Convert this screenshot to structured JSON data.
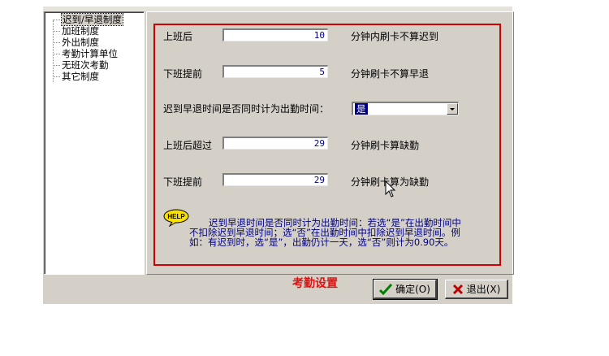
{
  "tree": {
    "items": [
      {
        "label": "迟到/早退制度",
        "selected": true
      },
      {
        "label": "加班制度"
      },
      {
        "label": "外出制度"
      },
      {
        "label": "考勤计算单位"
      },
      {
        "label": "无班次考勤"
      },
      {
        "label": "其它制度"
      }
    ]
  },
  "form": {
    "late_label": "上班后",
    "late_value": "10",
    "late_suffix": "分钟内刷卡不算迟到",
    "early_label": "下班提前",
    "early_value": "5",
    "early_suffix": "分钟刷卡不算早退",
    "count_label": "迟到早退时间是否同时计为出勤时间：",
    "count_value": "是",
    "absent_late_label": "上班后超过",
    "absent_late_value": "29",
    "absent_late_suffix": "分钟刷卡算缺勤",
    "absent_early_label": "下班提前",
    "absent_early_value": "29",
    "absent_early_suffix": "分钟刷卡算为缺勤"
  },
  "help": {
    "icon_label": "HELP",
    "line1": "迟到早退时间是否同时计为出勤时间：若选“是”在出勤时间中",
    "line2": "不扣除迟到早退时间；选“否”在出勤时间中扣除迟到早退时间。例",
    "line3": "如：有迟到时，选“是”，出勤仍计一天，选“否”则计为0.90天。"
  },
  "window_title": "考勤设置",
  "buttons": {
    "ok": "确定(O)",
    "exit": "退出(X)"
  },
  "colors": {
    "frame_red": "#d00000",
    "title_red": "#e01010",
    "help_text": "#000080",
    "dialog_bg": "#d4d0c8"
  }
}
